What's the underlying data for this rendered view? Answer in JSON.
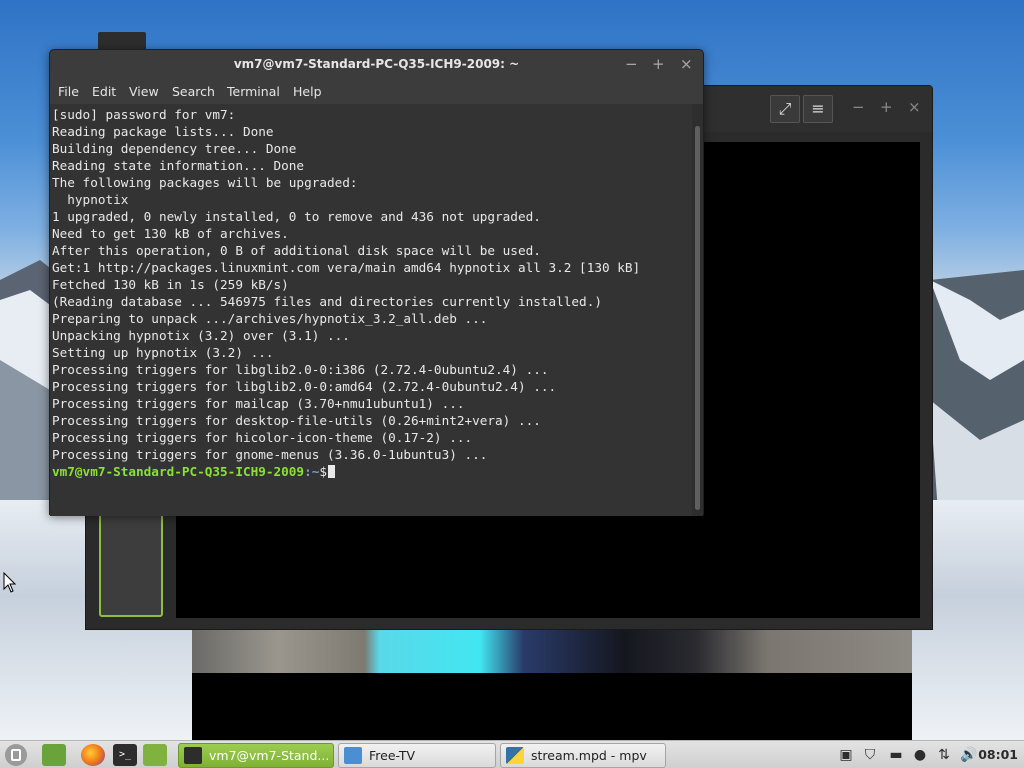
{
  "terminal": {
    "title": "vm7@vm7-Standard-PC-Q35-ICH9-2009: ~",
    "menu": [
      "File",
      "Edit",
      "View",
      "Search",
      "Terminal",
      "Help"
    ],
    "lines": [
      "[sudo] password for vm7:",
      "Reading package lists... Done",
      "Building dependency tree... Done",
      "Reading state information... Done",
      "The following packages will be upgraded:",
      "  hypnotix",
      "1 upgraded, 0 newly installed, 0 to remove and 436 not upgraded.",
      "Need to get 130 kB of archives.",
      "After this operation, 0 B of additional disk space will be used.",
      "Get:1 http://packages.linuxmint.com vera/main amd64 hypnotix all 3.2 [130 kB]",
      "Fetched 130 kB in 1s (259 kB/s)",
      "(Reading database ... 546975 files and directories currently installed.)",
      "Preparing to unpack .../archives/hypnotix_3.2_all.deb ...",
      "Unpacking hypnotix (3.2) over (3.1) ...",
      "Setting up hypnotix (3.2) ...",
      "Processing triggers for libglib2.0-0:i386 (2.72.4-0ubuntu2.4) ...",
      "Processing triggers for libglib2.0-0:amd64 (2.72.4-0ubuntu2.4) ...",
      "Processing triggers for mailcap (3.70+nmu1ubuntu1) ...",
      "Processing triggers for desktop-file-utils (0.26+mint2+vera) ...",
      "Processing triggers for hicolor-icon-theme (0.17-2) ...",
      "Processing triggers for gnome-menus (3.36.0-1ubuntu3) ..."
    ],
    "prompt_user_host": "vm7@vm7-Standard-PC-Q35-ICH9-2009",
    "prompt_path": ":~",
    "prompt_symbol": "$"
  },
  "background_window": {
    "fullscreen_icon": "fullscreen-icon",
    "menu_icon": "hamburger-menu-icon"
  },
  "taskbar": {
    "tasks": [
      {
        "label": "vm7@vm7-Stand...",
        "icon": "terminal-icon",
        "active": true
      },
      {
        "label": "Free-TV",
        "icon": "hypnotix-icon",
        "active": false
      },
      {
        "label": "stream.mpd - mpv",
        "icon": "python-icon",
        "active": false
      }
    ],
    "clock": "08:01"
  },
  "colors": {
    "prompt_green": "#8ae234",
    "prompt_blue": "#729fcf",
    "active_task": "#8fbf3f"
  }
}
